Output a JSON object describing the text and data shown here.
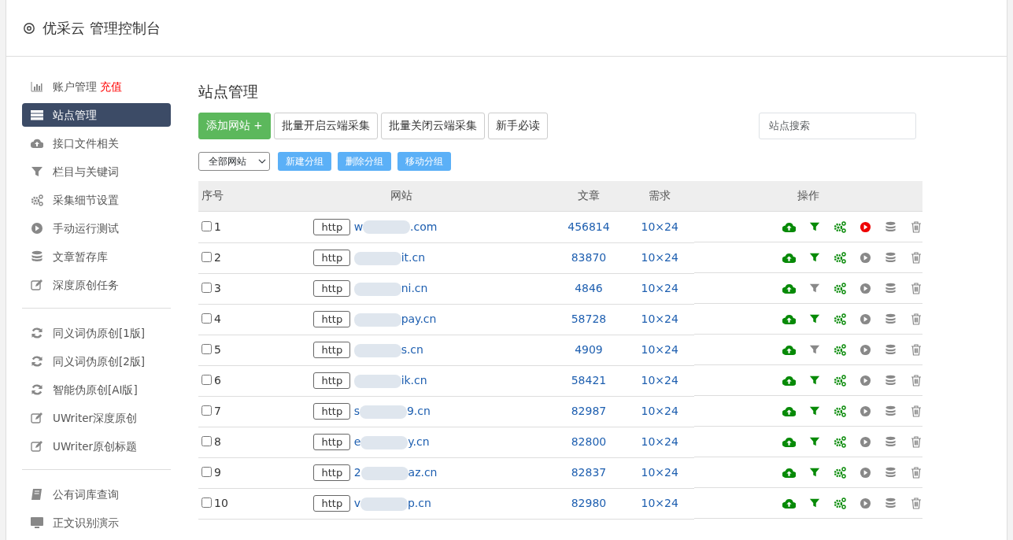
{
  "header": {
    "title": "优采云 管理控制台"
  },
  "sidebar": {
    "groups": [
      {
        "items": [
          {
            "kind": "chart",
            "label": "账户管理",
            "extra": "充值",
            "selected": false
          },
          {
            "kind": "server",
            "label": "站点管理",
            "selected": true
          },
          {
            "kind": "cloud",
            "label": "接口文件相关",
            "selected": false
          },
          {
            "kind": "filter",
            "label": "栏目与关键词",
            "selected": false
          },
          {
            "kind": "gears",
            "label": "采集细节设置",
            "selected": false
          },
          {
            "kind": "play",
            "label": "手动运行测试",
            "selected": false
          },
          {
            "kind": "db",
            "label": "文章暂存库",
            "selected": false
          },
          {
            "kind": "edit",
            "label": "深度原创任务",
            "selected": false
          }
        ]
      },
      {
        "items": [
          {
            "kind": "refresh",
            "label": "同义词伪原创[1版]",
            "selected": false
          },
          {
            "kind": "refresh",
            "label": "同义词伪原创[2版]",
            "selected": false
          },
          {
            "kind": "refresh",
            "label": "智能伪原创[AI版]",
            "selected": false
          },
          {
            "kind": "edit",
            "label": "UWriter深度原创",
            "selected": false
          },
          {
            "kind": "edit",
            "label": "UWriter原创标题",
            "selected": false
          }
        ]
      },
      {
        "items": [
          {
            "kind": "book",
            "label": "公有词库查询",
            "selected": false
          },
          {
            "kind": "monitor",
            "label": "正文识别演示",
            "selected": false
          }
        ]
      }
    ]
  },
  "main": {
    "title": "站点管理",
    "toolbar": [
      {
        "kind": "primary",
        "label": "添加网站 +"
      },
      {
        "kind": "outline",
        "label": "批量开启云端采集"
      },
      {
        "kind": "outline",
        "label": "批量关闭云端采集"
      },
      {
        "kind": "outline",
        "label": "新手必读"
      }
    ],
    "search": {
      "placeholder": "站点搜索"
    },
    "group_select": {
      "value": "全部网站"
    },
    "group_buttons": [
      "新建分组",
      "删除分组",
      "移动分组"
    ],
    "table": {
      "columns": [
        "序号",
        "网站",
        "文章",
        "需求",
        "操作"
      ],
      "rows": [
        {
          "checked": false,
          "index": "1",
          "scheme": "http",
          "prefix": "w",
          "suffix": ".com",
          "articles": "456814",
          "demand": "10×24",
          "filter_on": true,
          "running": true
        },
        {
          "checked": false,
          "index": "2",
          "scheme": "http",
          "prefix": "",
          "suffix": "it.cn",
          "articles": "83870",
          "demand": "10×24",
          "filter_on": true,
          "running": false
        },
        {
          "checked": false,
          "index": "3",
          "scheme": "http",
          "prefix": "",
          "suffix": "ni.cn",
          "articles": "4846",
          "demand": "10×24",
          "filter_on": false,
          "running": false
        },
        {
          "checked": false,
          "index": "4",
          "scheme": "http",
          "prefix": "",
          "suffix": "pay.cn",
          "articles": "58728",
          "demand": "10×24",
          "filter_on": true,
          "running": false
        },
        {
          "checked": false,
          "index": "5",
          "scheme": "http",
          "prefix": "",
          "suffix": "s.cn",
          "articles": "4909",
          "demand": "10×24",
          "filter_on": false,
          "running": false
        },
        {
          "checked": false,
          "index": "6",
          "scheme": "http",
          "prefix": "",
          "suffix": "ik.cn",
          "articles": "58421",
          "demand": "10×24",
          "filter_on": true,
          "running": false
        },
        {
          "checked": false,
          "index": "7",
          "scheme": "http",
          "prefix": "s",
          "suffix": "9.cn",
          "articles": "82987",
          "demand": "10×24",
          "filter_on": true,
          "running": false
        },
        {
          "checked": false,
          "index": "8",
          "scheme": "http",
          "prefix": "e",
          "suffix": "y.cn",
          "articles": "82800",
          "demand": "10×24",
          "filter_on": true,
          "running": false
        },
        {
          "checked": false,
          "index": "9",
          "scheme": "http",
          "prefix": "2",
          "suffix": "az.cn",
          "articles": "82837",
          "demand": "10×24",
          "filter_on": true,
          "running": false
        },
        {
          "checked": false,
          "index": "10",
          "scheme": "http",
          "prefix": "v",
          "suffix": "p.cn",
          "articles": "82980",
          "demand": "10×24",
          "filter_on": true,
          "running": false
        }
      ]
    }
  }
}
